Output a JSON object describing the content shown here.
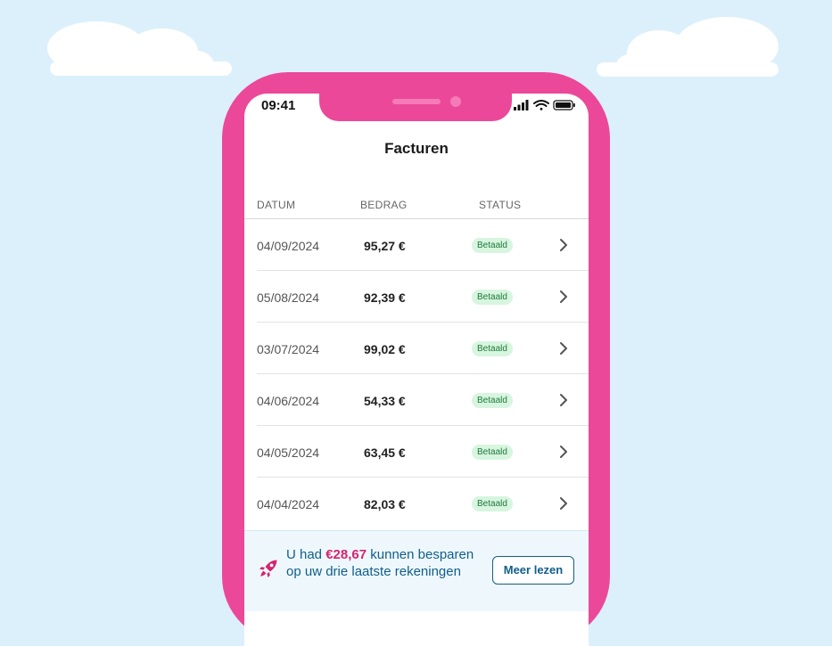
{
  "status_bar": {
    "time": "09:41"
  },
  "header": {
    "title": "Facturen"
  },
  "table": {
    "columns": [
      "DATUM",
      "BEDRAG",
      "STATUS"
    ],
    "rows": [
      {
        "date": "04/09/2024",
        "amount": "95,27 €",
        "status": "Betaald"
      },
      {
        "date": "05/08/2024",
        "amount": "92,39 €",
        "status": "Betaald"
      },
      {
        "date": "03/07/2024",
        "amount": "99,02 €",
        "status": "Betaald"
      },
      {
        "date": "04/06/2024",
        "amount": "54,33 €",
        "status": "Betaald"
      },
      {
        "date": "04/05/2024",
        "amount": "63,45 €",
        "status": "Betaald"
      },
      {
        "date": "04/04/2024",
        "amount": "82,03 €",
        "status": "Betaald"
      }
    ]
  },
  "promo": {
    "text_before": "U had",
    "highlight": "€28,67",
    "text_after": "kunnen besparen op uw drie laatste rekeningen",
    "button_label": "Meer lezen",
    "icon": "rocket-icon"
  },
  "colors": {
    "phone_frame": "#ec4899",
    "background_sky": "#dcf0fb",
    "promo_text": "#115e8a",
    "promo_highlight": "#d6246e",
    "badge_bg": "#d7f5df",
    "badge_text": "#1f7a3a"
  }
}
